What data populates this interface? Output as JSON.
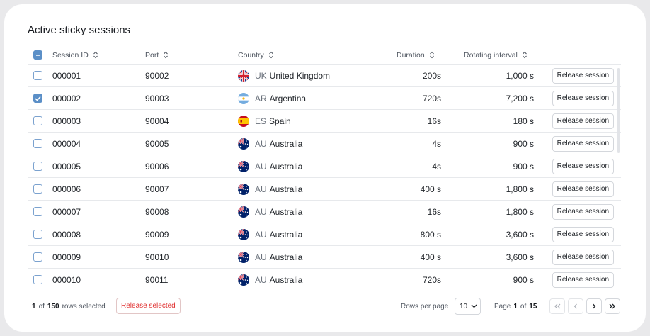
{
  "title": "Active sticky sessions",
  "columns": {
    "session_id": "Session ID",
    "port": "Port",
    "country": "Country",
    "duration": "Duration",
    "rotating_interval": "Rotating interval"
  },
  "rows": [
    {
      "id": "000001",
      "port": "90002",
      "code": "UK",
      "country": "United Kingdom",
      "flag": "uk",
      "duration": "200s",
      "interval": "1,000 s",
      "checked": false,
      "action": "Release session"
    },
    {
      "id": "000002",
      "port": "90003",
      "code": "AR",
      "country": "Argentina",
      "flag": "ar",
      "duration": "720s",
      "interval": "7,200 s",
      "checked": true,
      "action": "Release session"
    },
    {
      "id": "000003",
      "port": "90004",
      "code": "ES",
      "country": "Spain",
      "flag": "es",
      "duration": "16s",
      "interval": "180 s",
      "checked": false,
      "action": "Release session"
    },
    {
      "id": "000004",
      "port": "90005",
      "code": "AU",
      "country": "Australia",
      "flag": "au",
      "duration": "4s",
      "interval": "900 s",
      "checked": false,
      "action": "Release session"
    },
    {
      "id": "000005",
      "port": "90006",
      "code": "AU",
      "country": "Australia",
      "flag": "au",
      "duration": "4s",
      "interval": "900 s",
      "checked": false,
      "action": "Release session"
    },
    {
      "id": "000006",
      "port": "90007",
      "code": "AU",
      "country": "Australia",
      "flag": "au",
      "duration": "400 s",
      "interval": "1,800 s",
      "checked": false,
      "action": "Release session"
    },
    {
      "id": "000007",
      "port": "90008",
      "code": "AU",
      "country": "Australia",
      "flag": "au",
      "duration": "16s",
      "interval": "1,800 s",
      "checked": false,
      "action": "Release session"
    },
    {
      "id": "000008",
      "port": "90009",
      "code": "AU",
      "country": "Australia",
      "flag": "au",
      "duration": "800 s",
      "interval": "3,600 s",
      "checked": false,
      "action": "Release session"
    },
    {
      "id": "000009",
      "port": "90010",
      "code": "AU",
      "country": "Australia",
      "flag": "au",
      "duration": "400 s",
      "interval": "3,600 s",
      "checked": false,
      "action": "Release session"
    },
    {
      "id": "000010",
      "port": "90011",
      "code": "AU",
      "country": "Australia",
      "flag": "au",
      "duration": "720s",
      "interval": "900 s",
      "checked": false,
      "action": "Release session"
    }
  ],
  "footer": {
    "selected_count": "1",
    "of_label": "of",
    "total": "150",
    "rows_selected_label": "rows selected",
    "release_selected": "Release selected",
    "rows_per_page_label": "Rows per page",
    "rows_per_page_value": "10",
    "page_label": "Page",
    "page_current": "1",
    "page_of_label": "of",
    "page_total": "15"
  },
  "colors": {
    "accent": "#5b8fc7",
    "danger": "#e03131"
  },
  "icons": [
    "sort-icon",
    "chevron-down-icon",
    "first-page-icon",
    "prev-page-icon",
    "next-page-icon",
    "last-page-icon"
  ]
}
